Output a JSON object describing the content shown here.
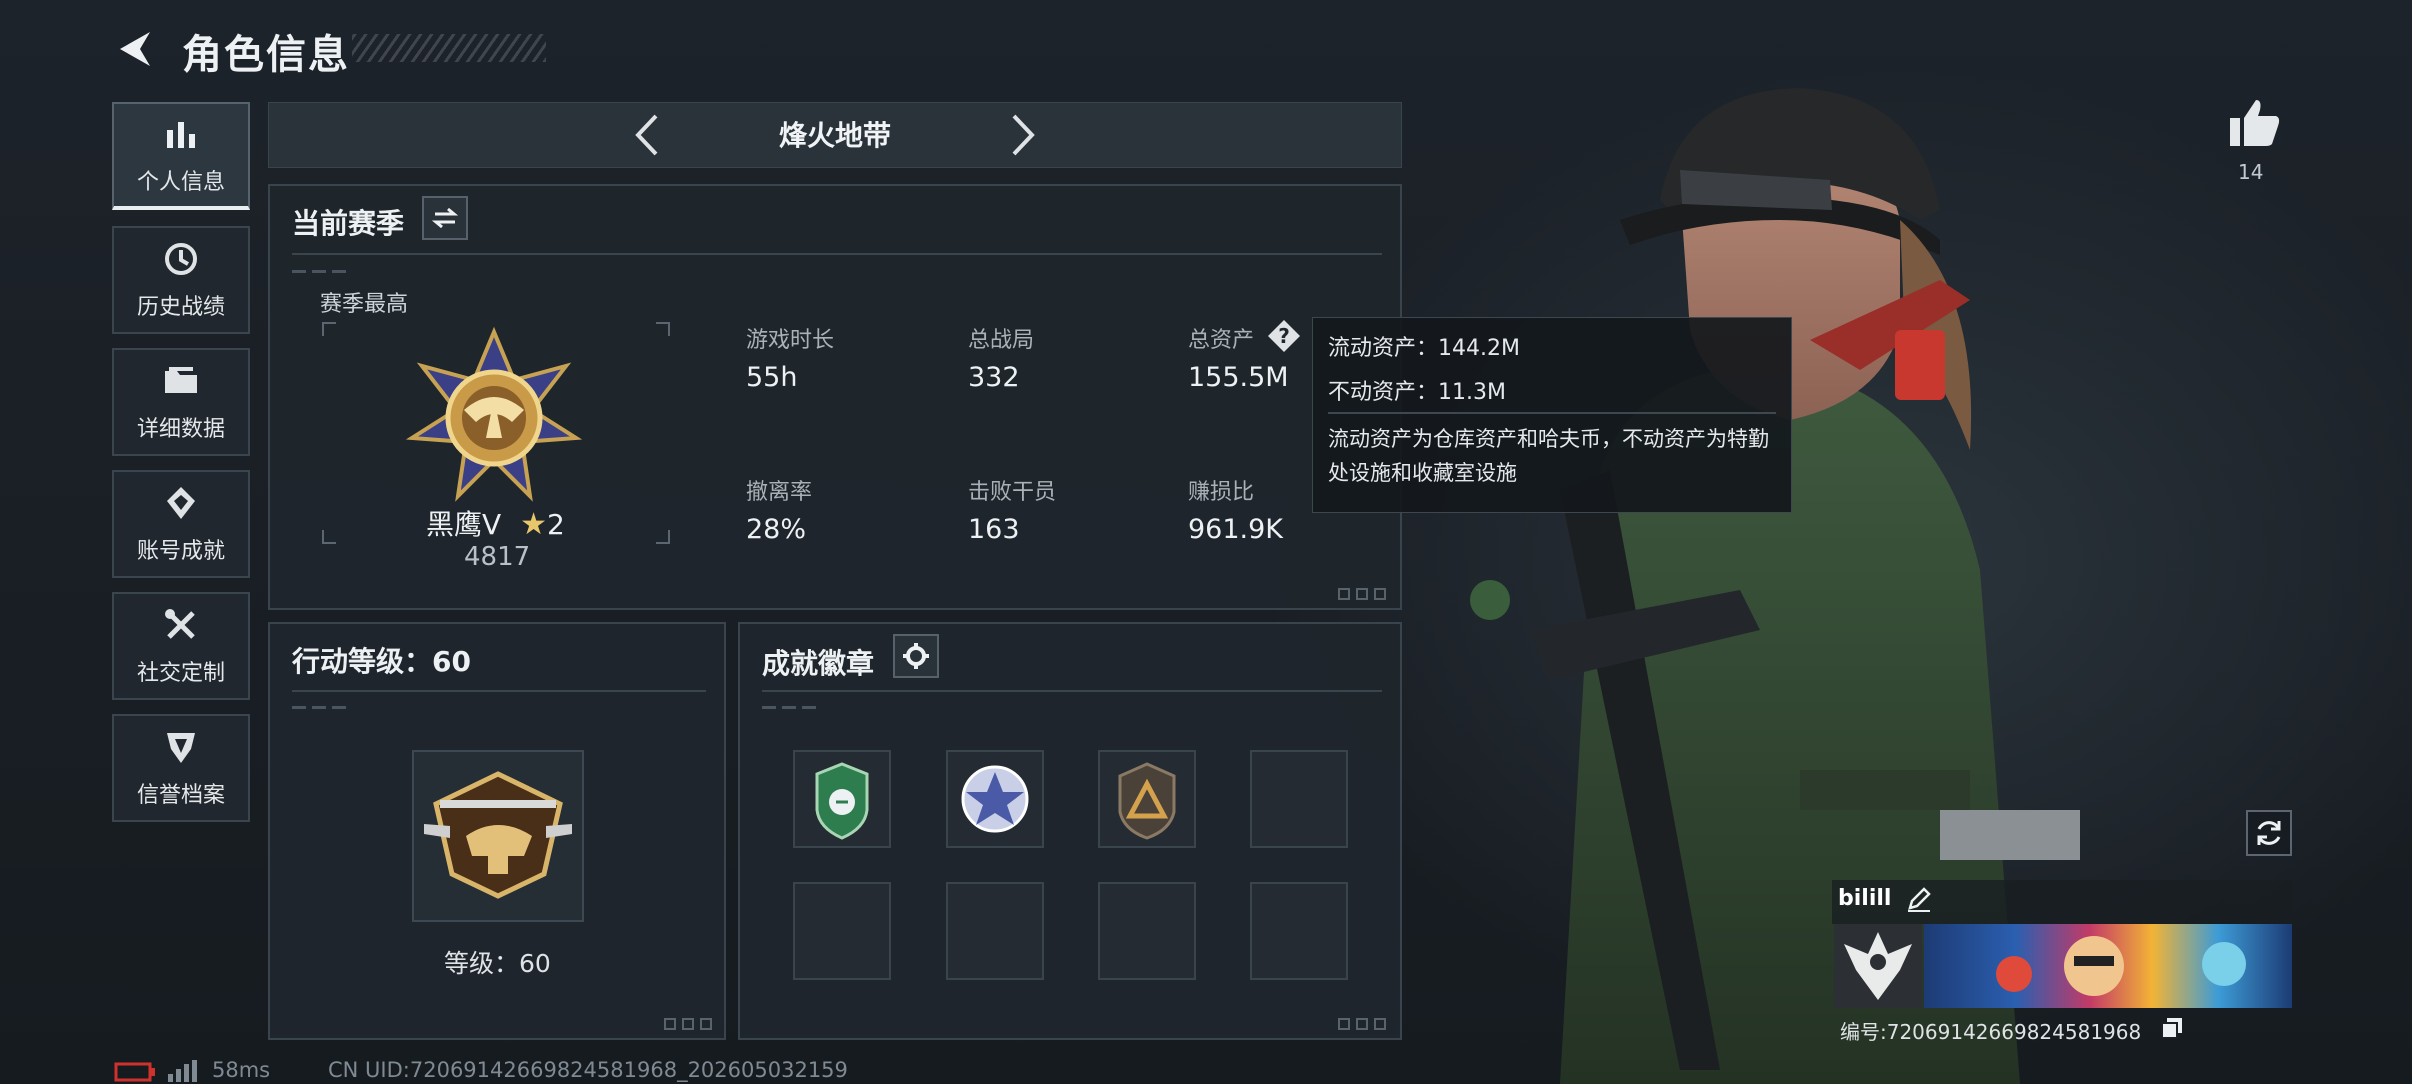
{
  "header": {
    "title": "角色信息"
  },
  "sidebar": {
    "items": [
      {
        "label": "个人信息",
        "icon": "bar-chart-icon",
        "active": true
      },
      {
        "label": "历史战绩",
        "icon": "history-icon",
        "active": false
      },
      {
        "label": "详细数据",
        "icon": "folder-icon",
        "active": false
      },
      {
        "label": "账号成就",
        "icon": "achievement-icon",
        "active": false
      },
      {
        "label": "社交定制",
        "icon": "tools-icon",
        "active": false
      },
      {
        "label": "信誉档案",
        "icon": "shield-icon",
        "active": false
      }
    ]
  },
  "mode": {
    "title": "烽火地带"
  },
  "season": {
    "title": "当前赛季",
    "best_label": "赛季最高",
    "rank_name": "黑鹰V",
    "rank_star": "2",
    "rank_score": "4817",
    "stats": [
      {
        "label": "游戏时长",
        "value": "55h"
      },
      {
        "label": "总战局",
        "value": "332"
      },
      {
        "label": "总资产",
        "value": "155.5M"
      },
      {
        "label": "撤离率",
        "value": "28%"
      },
      {
        "label": "击败干员",
        "value": "163"
      },
      {
        "label": "赚损比",
        "value": "961.9K"
      }
    ]
  },
  "tooltip": {
    "liquid": "流动资产：144.2M",
    "fixed": "不动资产：11.3M",
    "desc": "流动资产为仓库资产和哈夫币，不动资产为特勤处设施和收藏室设施"
  },
  "action_level": {
    "title": "行动等级：60",
    "level_text": "等级：60"
  },
  "badges": {
    "title": "成就徽章"
  },
  "likes": {
    "count": "14"
  },
  "player": {
    "name": "bilill",
    "id_text": "编号:7206914266982458196​8"
  },
  "footer": {
    "ping": "58ms",
    "uid": "CN UID:7206914266982458196​8_202605032159"
  },
  "colors": {
    "accent": "#e8c76a",
    "panel": "#1f262d",
    "green_badge": "#2e7d4f"
  }
}
